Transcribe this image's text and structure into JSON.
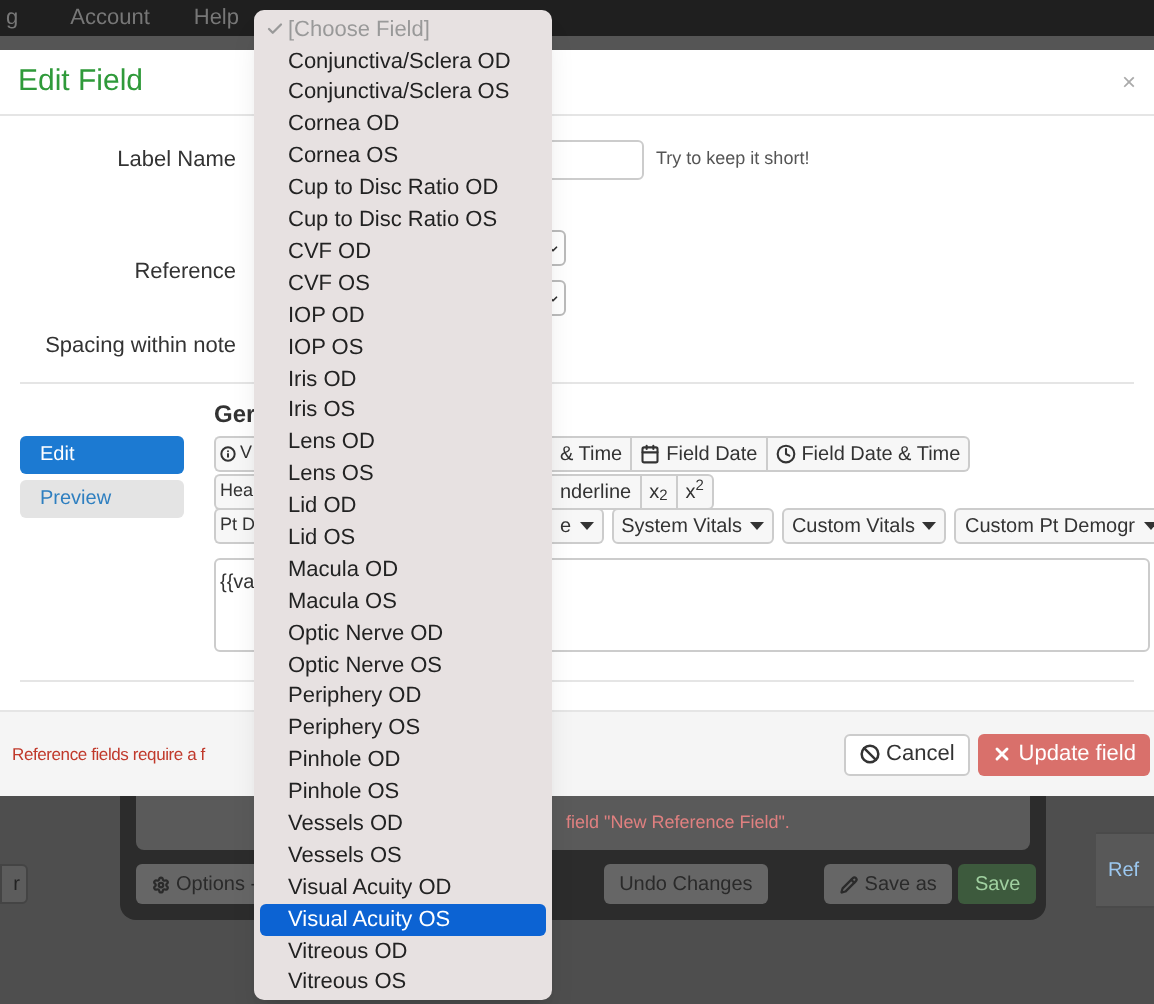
{
  "navbar": {
    "items": [
      "g",
      "Account",
      "Help"
    ]
  },
  "modal": {
    "title": "Edit Field",
    "close": "×",
    "fields": [
      {
        "label": "Label Name",
        "kind": "text",
        "hint": "Try to keep it short!"
      },
      {
        "label": "Reference",
        "kind": "selects"
      },
      {
        "label": "Spacing within note",
        "kind": "blank"
      }
    ],
    "section_title": "Ger",
    "side_tabs": [
      {
        "label": "Edit",
        "selected": true
      },
      {
        "label": "Preview",
        "selected": false
      }
    ],
    "toolbar_rows": [
      {
        "left": "V",
        "buttons": [
          {
            "label": "& Time",
            "caret": false
          },
          {
            "label": "Field Date",
            "caret": false
          },
          {
            "label": "Field Date & Time",
            "caret": false
          }
        ]
      },
      {
        "left": "Hea",
        "buttons": [
          {
            "label": "nderline",
            "caret": false
          },
          {
            "label": "x$_{2}$",
            "caret": false
          },
          {
            "label": "x$^{2}$",
            "caret": false
          }
        ]
      },
      {
        "left": "Pt D",
        "buttons": [
          {
            "label": "e",
            "caret": true
          },
          {
            "label": "System Vitals",
            "caret": true
          },
          {
            "label": "Custom Vitals",
            "caret": true
          },
          {
            "label": "Custom Pt Demogr",
            "caret": true
          }
        ]
      }
    ],
    "editor": {
      "value": "{{va"
    },
    "footer": {
      "message": "Reference fields require a f",
      "buttons": [
        "Cancel",
        "Update field"
      ]
    }
  },
  "background": {
    "left_button": "r",
    "message": "field \"New Reference Field\".",
    "buttons": [
      "Options -",
      "Undo Changes",
      "Save as",
      "Save"
    ],
    "right_item": "Ref"
  },
  "dropdown": {
    "items": [
      {
        "label": "[Choose Field]",
        "checked": true,
        "selected": false
      },
      {
        "label": "Conjunctiva/Sclera OD",
        "checked": false,
        "selected": false
      },
      {
        "label": "Conjunctiva/Sclera OS",
        "checked": false,
        "selected": false
      },
      {
        "label": "Cornea OD",
        "checked": false,
        "selected": false
      },
      {
        "label": "Cornea OS",
        "checked": false,
        "selected": false
      },
      {
        "label": "Cup to Disc Ratio OD",
        "checked": false,
        "selected": false
      },
      {
        "label": "Cup to Disc Ratio OS",
        "checked": false,
        "selected": false
      },
      {
        "label": "CVF OD",
        "checked": false,
        "selected": false
      },
      {
        "label": "CVF OS",
        "checked": false,
        "selected": false
      },
      {
        "label": "IOP OD",
        "checked": false,
        "selected": false
      },
      {
        "label": "IOP OS",
        "checked": false,
        "selected": false
      },
      {
        "label": "Iris OD",
        "checked": false,
        "selected": false
      },
      {
        "label": "Iris OS",
        "checked": false,
        "selected": false
      },
      {
        "label": "Lens OD",
        "checked": false,
        "selected": false
      },
      {
        "label": "Lens OS",
        "checked": false,
        "selected": false
      },
      {
        "label": "Lid OD",
        "checked": false,
        "selected": false
      },
      {
        "label": "Lid OS",
        "checked": false,
        "selected": false
      },
      {
        "label": "Macula OD",
        "checked": false,
        "selected": false
      },
      {
        "label": "Macula OS",
        "checked": false,
        "selected": false
      },
      {
        "label": "Optic Nerve OD",
        "checked": false,
        "selected": false
      },
      {
        "label": "Optic Nerve OS",
        "checked": false,
        "selected": false
      },
      {
        "label": "Periphery OD",
        "checked": false,
        "selected": false
      },
      {
        "label": "Periphery OS",
        "checked": false,
        "selected": false
      },
      {
        "label": "Pinhole OD",
        "checked": false,
        "selected": false
      },
      {
        "label": "Pinhole OS",
        "checked": false,
        "selected": false
      },
      {
        "label": "Vessels OD",
        "checked": false,
        "selected": false
      },
      {
        "label": "Vessels OS",
        "checked": false,
        "selected": false
      },
      {
        "label": "Visual Acuity OD",
        "checked": false,
        "selected": false
      },
      {
        "label": "Visual Acuity OS",
        "checked": false,
        "selected": true
      },
      {
        "label": "Vitreous OD",
        "checked": false,
        "selected": false
      },
      {
        "label": "Vitreous OS",
        "checked": false,
        "selected": false
      }
    ]
  }
}
